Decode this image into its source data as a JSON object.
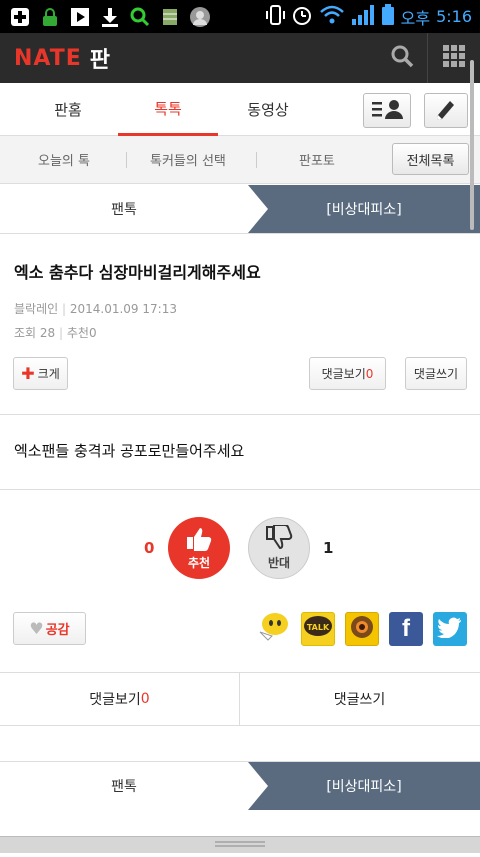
{
  "status_bar": {
    "time_prefix": "오후",
    "time": "5:16",
    "icons": [
      "add-icon",
      "lock-icon",
      "play-icon",
      "download-icon",
      "search-icon",
      "storage-icon",
      "avatar-icon",
      "phone-vibrate-icon",
      "alarm-icon",
      "wifi-icon",
      "signal-icon",
      "battery-icon"
    ]
  },
  "app_bar": {
    "logo": "NATE",
    "logo_sub": "판",
    "colors": {
      "brand": "#e8372a",
      "bar": "#2b2b2b"
    }
  },
  "tabs": {
    "items": [
      {
        "label": "판홈"
      },
      {
        "label": "톡톡",
        "active": true
      },
      {
        "label": "동영상"
      }
    ]
  },
  "subtabs": {
    "items": [
      {
        "label": "오늘의 톡"
      },
      {
        "label": "톡커들의 선택"
      },
      {
        "label": "판포토"
      }
    ],
    "all_button": "전체목록"
  },
  "band": {
    "left": "팬톡",
    "right": "[비상대피소]",
    "right_color": "#5a6b80"
  },
  "article": {
    "title": "엑소 춤추다 심장마비걸리게해주세요",
    "author": "블락레인",
    "date": "2014.01.09 17:13",
    "views_label": "조회",
    "views": "28",
    "recommend_label": "추천",
    "recommend_count": "0",
    "enlarge_button": "크게",
    "view_comments_label": "댓글보기",
    "view_comments_count": "0",
    "write_comment": "댓글쓰기",
    "body": "엑소팬들 충격과 공포로만들어주세요"
  },
  "vote": {
    "recommend_label": "추천",
    "recommend_count": "0",
    "oppose_label": "반대",
    "oppose_count": "1"
  },
  "share": {
    "like_label": "공감",
    "icons": [
      "comment-icon",
      "kakaotalk-icon",
      "kakaostory-icon",
      "facebook-icon",
      "twitter-icon"
    ]
  },
  "comment_bar": {
    "view_label": "댓글보기",
    "view_count": "0",
    "write_label": "댓글쓰기"
  },
  "bottom_band": {
    "left": "팬톡",
    "right": "[비상대피소]"
  }
}
